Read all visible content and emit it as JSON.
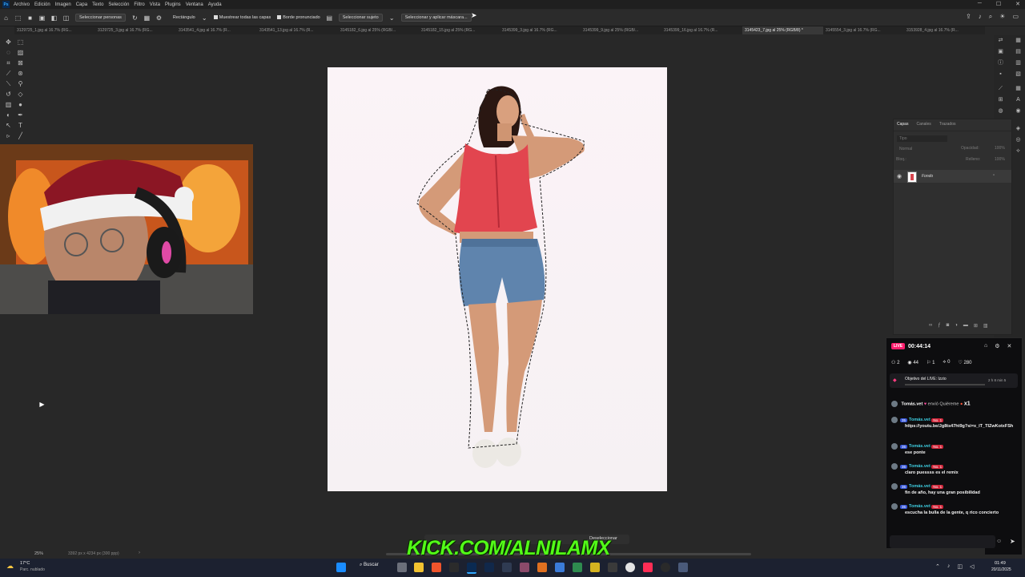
{
  "menubar": {
    "items": [
      "Archivo",
      "Edición",
      "Imagen",
      "Capa",
      "Texto",
      "Selección",
      "Filtro",
      "Vista",
      "Plugins",
      "Ventana",
      "Ayuda"
    ]
  },
  "options": {
    "select_subject_dropdown": "Seleccionar personas",
    "shape": "Rectángulo",
    "sample_all_layers": "Muestrear todas las capas",
    "hard_edge": "Borde pronunciado",
    "select_subject": "Seleccionar sujeto",
    "select_and_mask": "Seleccionar y aplicar máscara..."
  },
  "tabs": [
    "3129725_1.jpg al 16.7% (RG...",
    "3129725_3.jpg al 16.7% (RG...",
    "3143541_4.jpg al 16.7% (R...",
    "3143541_13.jpg al 16.7% (R...",
    "3145182_6.jpg al 25% (RGB/...",
    "3145182_15.jpg al 25% (RG...",
    "3145399_3.jpg al 16.7% (RG...",
    "3145399_9.jpg al 25% (RGB/...",
    "3145399_16.jpg al 16.7% (R...",
    "3145423_7.jpg al 25% (RGB/8) *",
    "3145554_3.jpg al 16.7% (RG...",
    "3153928_4.jpg al 16.7% (R..."
  ],
  "active_tab_index": 9,
  "layers_panel": {
    "tabs": [
      "Capas",
      "Canales",
      "Trazados"
    ],
    "search_placeholder": "Tipo",
    "blend_mode": "Normal",
    "opacity_label": "Opacidad:",
    "opacity_value": "100%",
    "lock_label": "Bloq.:",
    "fill_label": "Relleno:",
    "fill_value": "100%",
    "layer_name": "Fondo"
  },
  "status": {
    "zoom": "25%",
    "doc_info": "3392 px x 4234 px (300 ppp)"
  },
  "contextual_bar": {
    "label": "Deseleccionar"
  },
  "chat": {
    "live_label": "LIVE",
    "timer": "00:44:14",
    "stats": {
      "followers": "2",
      "viewers": "44",
      "subs": "1",
      "gifts": "0",
      "likes": "280"
    },
    "goal_label": "Objetivo del LIVE: Izzio",
    "goal_time": "2 h 8 min 5",
    "gift": {
      "user": "Tomás.vet",
      "text": "envió Quiéreme",
      "count": "x1"
    },
    "messages": [
      {
        "user": "Tomás.vet",
        "level": "35",
        "rank": "No. 1",
        "text": "https://youtu.be/Jg8ts47ht9g?si=x_iT_TIZwKotxFSh"
      },
      {
        "user": "Tomás.vet",
        "level": "35",
        "rank": "No. 1",
        "text": "ese ponte"
      },
      {
        "user": "Tomás.vet",
        "level": "35",
        "rank": "No. 1",
        "text": "claro puessss es el remix"
      },
      {
        "user": "Tomás.vet",
        "level": "35",
        "rank": "No. 1",
        "text": "fin de año, hay una gran posibilidad"
      },
      {
        "user": "Tomás.vet",
        "level": "35",
        "rank": "No. 1",
        "text": "escucha la bulla de la gente, q rico concierto"
      }
    ]
  },
  "overlay": {
    "kick_text": "KICK.COM/ALNILAMX"
  },
  "taskbar": {
    "weather_temp": "17°C",
    "weather_desc": "Parc. nublado",
    "search_label": "Buscar",
    "time": "01:49",
    "date": "20/11/2025"
  },
  "colors": {
    "accent_live": "#ff1e6e",
    "kick_green": "#53fc18",
    "ps_blue": "#31a8ff"
  }
}
